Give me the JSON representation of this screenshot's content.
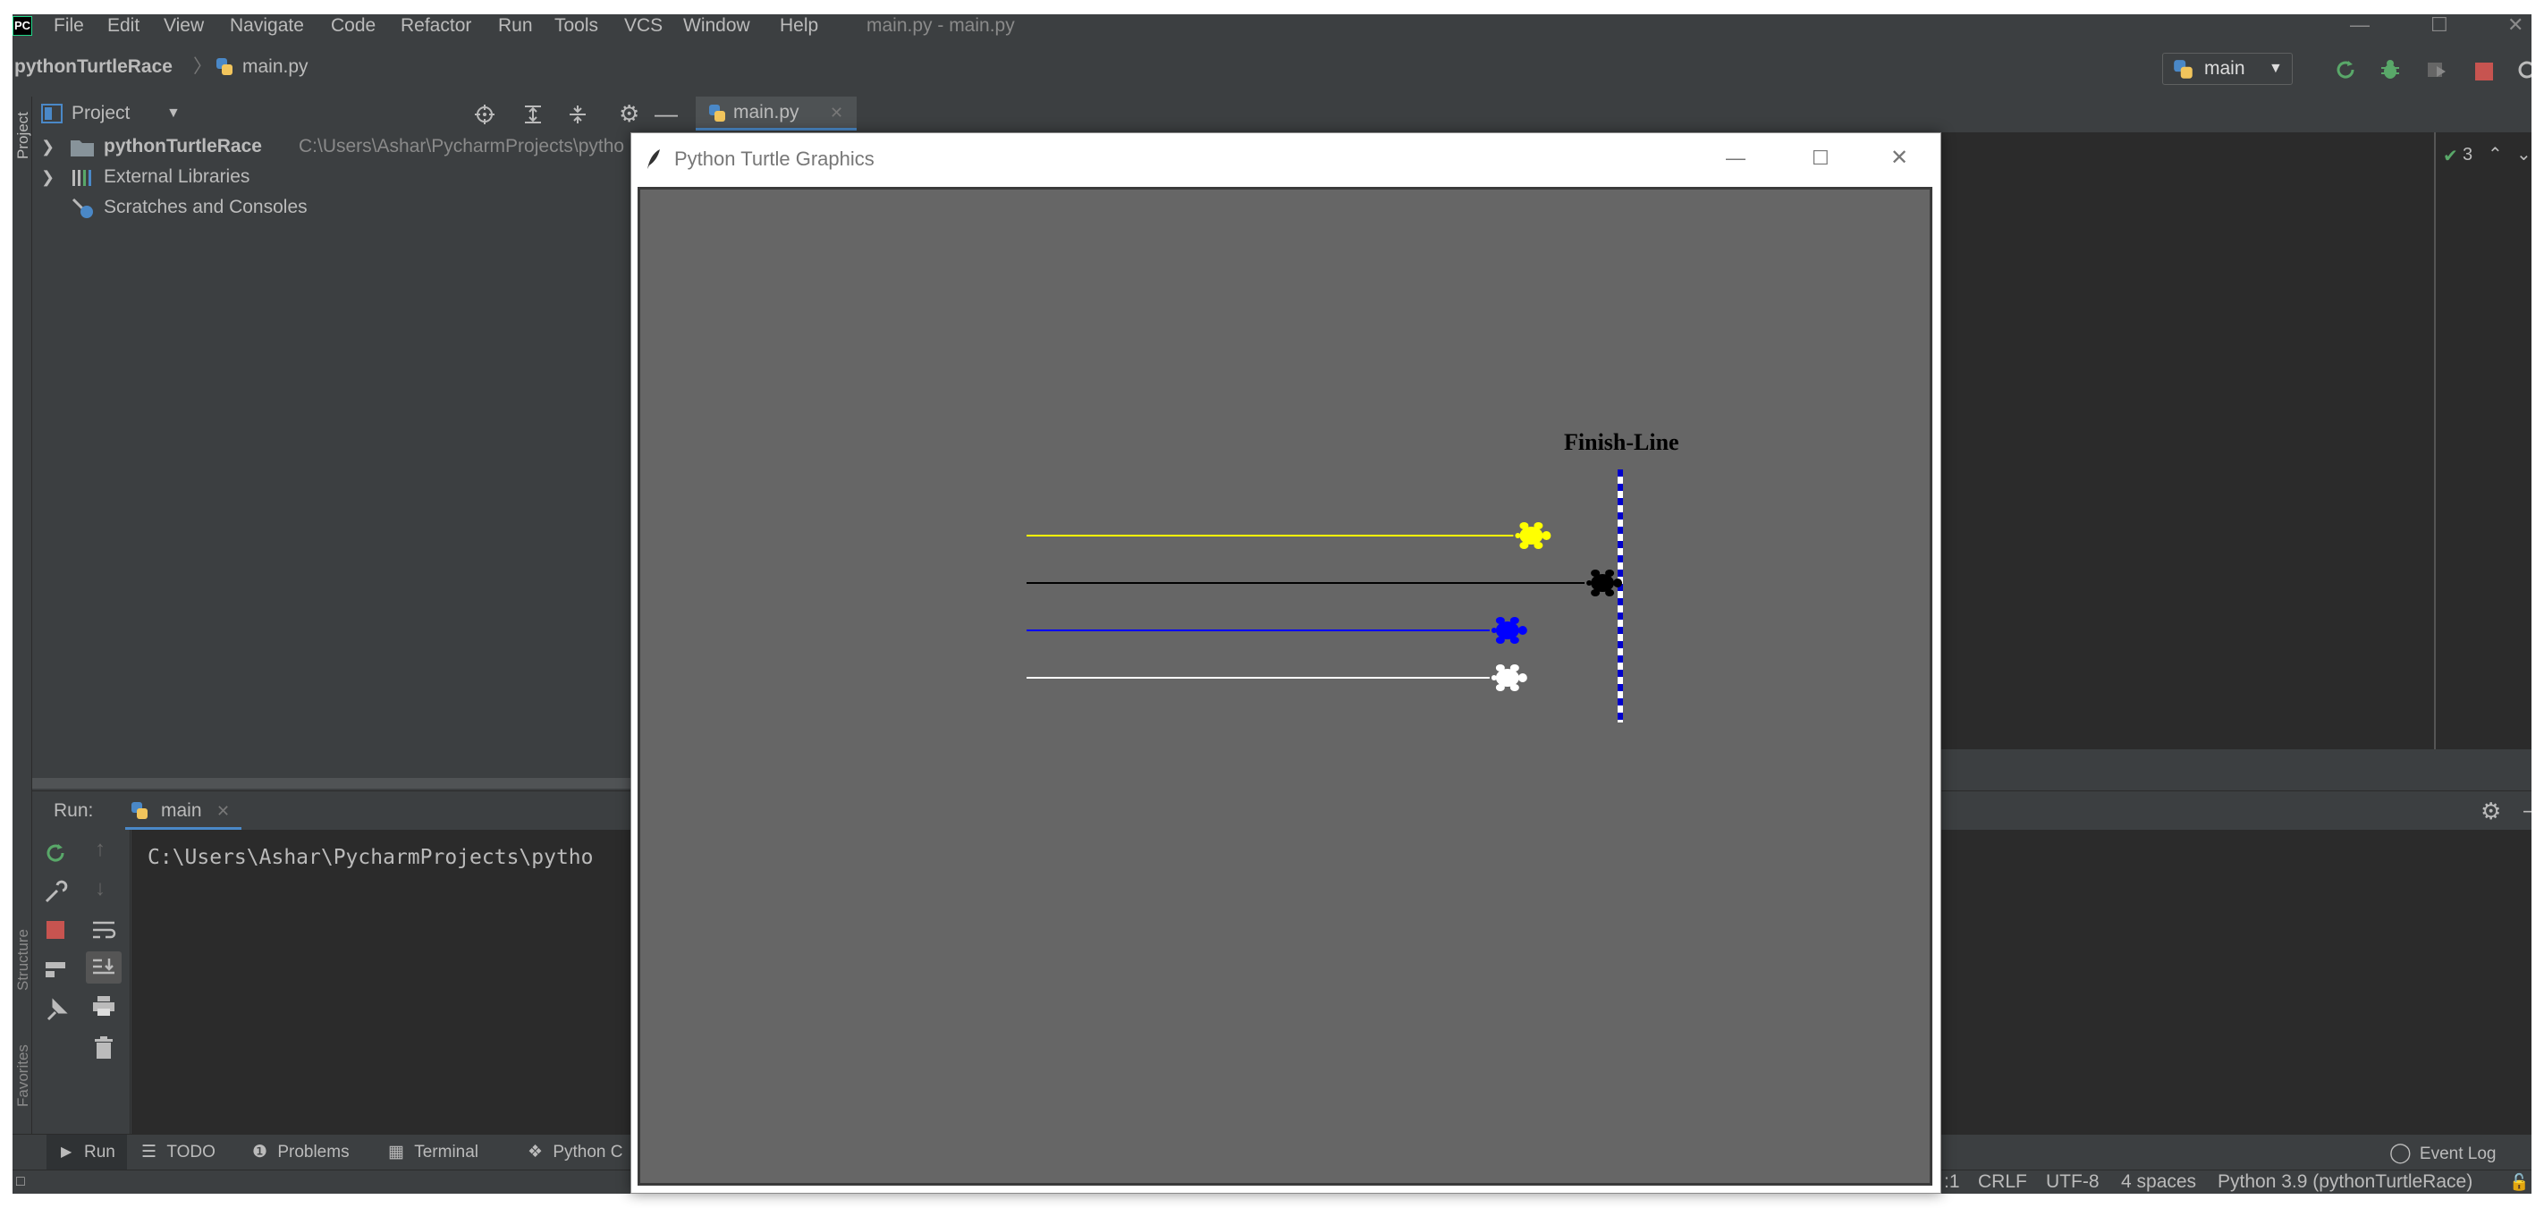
{
  "menubar": {
    "logo": "PC",
    "items": [
      "File",
      "Edit",
      "View",
      "Navigate",
      "Code",
      "Refactor",
      "Run",
      "Tools",
      "VCS",
      "Window",
      "Help"
    ],
    "window_title": "main.py - main.py"
  },
  "navbar": {
    "project": "pythonTurtleRace",
    "file": "main.py",
    "run_config": "main"
  },
  "project_panel": {
    "title": "Project",
    "tree": [
      {
        "name": "pythonTurtleRace",
        "path": "C:\\Users\\Ashar\\PycharmProjects\\pytho"
      },
      {
        "name": "External Libraries"
      },
      {
        "name": "Scratches and Consoles"
      }
    ]
  },
  "side_labels": {
    "project": "Project",
    "structure": "Structure",
    "favorites": "Favorites"
  },
  "editor": {
    "tab": "main.py",
    "inspection_count": "3"
  },
  "run_panel": {
    "label": "Run:",
    "tab": "main",
    "console_line": "C:\\Users\\Ashar\\PycharmProjects\\pytho"
  },
  "bottom_tabs": [
    "Run",
    "TODO",
    "Problems",
    "Terminal",
    "Python C"
  ],
  "event_log": "Event Log",
  "statusbar": {
    "position": ":1",
    "line_sep": "CRLF",
    "encoding": "UTF-8",
    "indent": "4 spaces",
    "interpreter": "Python 3.9 (pythonTurtleRace)"
  },
  "turtle_window": {
    "title": "Python Turtle Graphics",
    "finish_label": "Finish-Line",
    "background": "#666666",
    "turtles": [
      {
        "color": "#ffff00",
        "progress": 0.85
      },
      {
        "color": "#000000",
        "progress": 0.97
      },
      {
        "color": "#0000ff",
        "progress": 0.81
      },
      {
        "color": "#ffffff",
        "progress": 0.81
      }
    ]
  },
  "colors": {
    "ide_bg": "#3c3f41",
    "editor_bg": "#2b2b2b",
    "run_green": "#59a869",
    "stop_red": "#c75450"
  }
}
